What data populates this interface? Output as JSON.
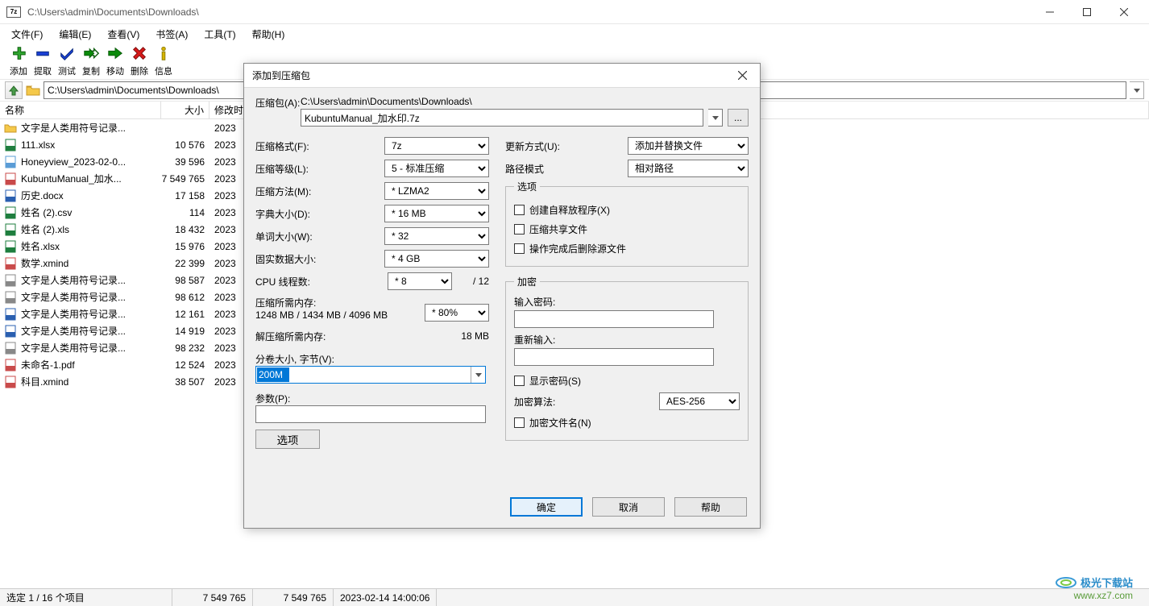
{
  "window": {
    "title": "C:\\Users\\admin\\Documents\\Downloads\\",
    "app_icon_text": "7z"
  },
  "menu": [
    "文件(F)",
    "编辑(E)",
    "查看(V)",
    "书签(A)",
    "工具(T)",
    "帮助(H)"
  ],
  "toolbar": [
    {
      "label": "添加",
      "color": "#2fa52f",
      "shape": "plus"
    },
    {
      "label": "提取",
      "color": "#1a3fd4",
      "shape": "minus"
    },
    {
      "label": "测试",
      "color": "#1a3fd4",
      "shape": "check"
    },
    {
      "label": "复制",
      "color": "#0a8a0a",
      "shape": "rarrow2"
    },
    {
      "label": "移动",
      "color": "#0a8a0a",
      "shape": "rarrow"
    },
    {
      "label": "删除",
      "color": "#d61a1a",
      "shape": "x"
    },
    {
      "label": "信息",
      "color": "#d6b300",
      "shape": "info"
    }
  ],
  "address": "C:\\Users\\admin\\Documents\\Downloads\\",
  "columns": {
    "name": "名称",
    "size": "大小",
    "date": "修改时"
  },
  "files": [
    {
      "icon": "folder",
      "name": "文字是人类用符号记录...",
      "size": "",
      "date": "2023"
    },
    {
      "icon": "xlsx",
      "name": "111.xlsx",
      "size": "10 576",
      "date": "2023"
    },
    {
      "icon": "img",
      "name": "Honeyview_2023-02-0...",
      "size": "39 596",
      "date": "2023"
    },
    {
      "icon": "pdf",
      "name": "KubuntuManual_加水...",
      "size": "7 549 765",
      "date": "2023"
    },
    {
      "icon": "docx",
      "name": "历史.docx",
      "size": "17 158",
      "date": "2023"
    },
    {
      "icon": "csv",
      "name": "姓名 (2).csv",
      "size": "114",
      "date": "2023"
    },
    {
      "icon": "xls",
      "name": "姓名 (2).xls",
      "size": "18 432",
      "date": "2023"
    },
    {
      "icon": "xlsx",
      "name": "姓名.xlsx",
      "size": "15 976",
      "date": "2023"
    },
    {
      "icon": "xmind",
      "name": "数学.xmind",
      "size": "22 399",
      "date": "2023"
    },
    {
      "icon": "doc",
      "name": "文字是人类用符号记录...",
      "size": "98 587",
      "date": "2023"
    },
    {
      "icon": "doc",
      "name": "文字是人类用符号记录...",
      "size": "98 612",
      "date": "2023"
    },
    {
      "icon": "docx2",
      "name": "文字是人类用符号记录...",
      "size": "12 161",
      "date": "2023"
    },
    {
      "icon": "docx",
      "name": "文字是人类用符号记录...",
      "size": "14 919",
      "date": "2023"
    },
    {
      "icon": "doc",
      "name": "文字是人类用符号记录...",
      "size": "98 232",
      "date": "2023"
    },
    {
      "icon": "pdf",
      "name": "未命名-1.pdf",
      "size": "12 524",
      "date": "2023"
    },
    {
      "icon": "xmind",
      "name": "科目.xmind",
      "size": "38 507",
      "date": "2023"
    }
  ],
  "status": {
    "selected": "选定 1 / 16 个项目",
    "s1": "7 549 765",
    "s2": "7 549 765",
    "datetime": "2023-02-14 14:00:06"
  },
  "watermark": {
    "line1": "极光下载站",
    "line2": "www.xz7.com"
  },
  "dialog": {
    "title": "添加到压缩包",
    "archive_label": "压缩包(A):",
    "archive_path": "C:\\Users\\admin\\Documents\\Downloads\\",
    "archive_name": "KubuntuManual_加水印.7z",
    "left": {
      "format_label": "压缩格式(F):",
      "format": "7z",
      "level_label": "压缩等级(L):",
      "level": "5 - 标准压缩",
      "method_label": "压缩方法(M):",
      "method": "* LZMA2",
      "dict_label": "字典大小(D):",
      "dict": "* 16 MB",
      "word_label": "单词大小(W):",
      "word": "* 32",
      "solid_label": "固实数据大小:",
      "solid": "* 4 GB",
      "cpu_label": "CPU 线程数:",
      "cpu": "* 8",
      "cpu_total": "/ 12",
      "mem_c_label": "压缩所需内存:",
      "mem_c_val": "1248 MB / 1434 MB / 4096 MB",
      "mem_pct": "* 80%",
      "mem_d_label": "解压缩所需内存:",
      "mem_d_val": "18 MB",
      "vol_label": "分卷大小, 字节(V):",
      "vol": "200M",
      "param_label": "参数(P):",
      "opt_btn": "选项"
    },
    "right": {
      "update_label": "更新方式(U):",
      "update": "添加并替换文件",
      "path_label": "路径模式",
      "path": "相对路径",
      "options_legend": "选项",
      "opt1": "创建自释放程序(X)",
      "opt2": "压缩共享文件",
      "opt3": "操作完成后删除源文件",
      "enc_legend": "加密",
      "enc_pw_label": "输入密码:",
      "enc_pw2_label": "重新输入:",
      "enc_show": "显示密码(S)",
      "enc_alg_label": "加密算法:",
      "enc_alg": "AES-256",
      "enc_names": "加密文件名(N)"
    },
    "buttons": {
      "ok": "确定",
      "cancel": "取消",
      "help": "帮助"
    }
  }
}
